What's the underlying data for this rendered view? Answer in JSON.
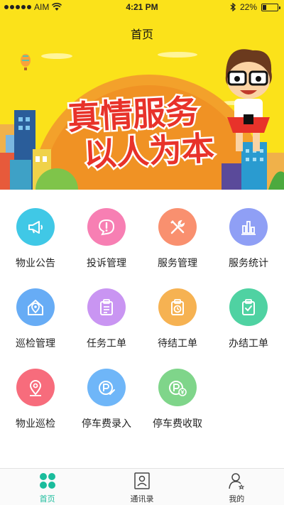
{
  "status_bar": {
    "carrier": "AIM",
    "time": "4:21 PM",
    "battery": "22%",
    "battery_level": 0.22
  },
  "nav": {
    "title": "首页"
  },
  "banner": {
    "line1": "真情服务",
    "line2": "以人为本"
  },
  "grid": [
    {
      "label": "物业公告",
      "icon": "megaphone-icon",
      "color": "#40c8e6"
    },
    {
      "label": "投诉管理",
      "icon": "alert-icon",
      "color": "#f77fb3"
    },
    {
      "label": "服务管理",
      "icon": "tools-icon",
      "color": "#f9906f"
    },
    {
      "label": "服务统计",
      "icon": "bar-chart-icon",
      "color": "#8f9ff5"
    },
    {
      "label": "巡检管理",
      "icon": "house-location-icon",
      "color": "#67acf5"
    },
    {
      "label": "任务工单",
      "icon": "clipboard-icon",
      "color": "#c995f2"
    },
    {
      "label": "待结工单",
      "icon": "clipboard-clock-icon",
      "color": "#f6b252"
    },
    {
      "label": "办结工单",
      "icon": "clipboard-check-icon",
      "color": "#4fd2a2"
    },
    {
      "label": "物业巡检",
      "icon": "map-pin-icon",
      "color": "#f76c7c"
    },
    {
      "label": "停车费录入",
      "icon": "parking-edit-icon",
      "color": "#6fb6f8"
    },
    {
      "label": "停车费收取",
      "icon": "parking-yuan-icon",
      "color": "#7fd58a"
    }
  ],
  "tabs": [
    {
      "label": "首页",
      "icon": "clover-icon",
      "active": true
    },
    {
      "label": "通讯录",
      "icon": "contacts-icon",
      "active": false
    },
    {
      "label": "我的",
      "icon": "profile-icon",
      "active": false
    }
  ],
  "colors": {
    "header_bg": "#fbe21a",
    "accent": "#1abc9c",
    "banner_text": "#e8322a"
  }
}
